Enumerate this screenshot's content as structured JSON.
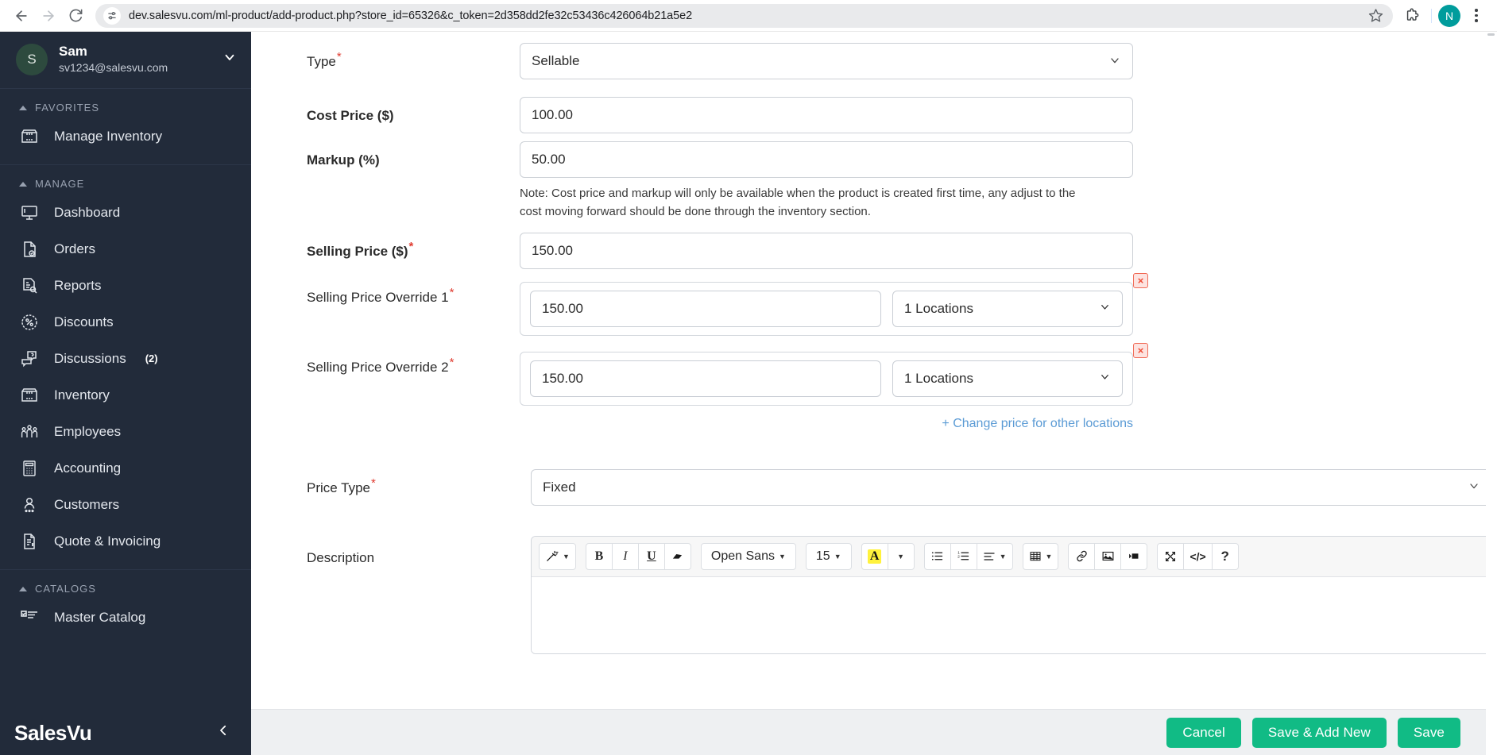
{
  "browser": {
    "url": "dev.salesvu.com/ml-product/add-product.php?store_id=65326&c_token=2d358dd2fe32c53436c426064b21a5e2",
    "back_icon": "back-arrow-icon",
    "forward_icon": "forward-arrow-icon",
    "reload_icon": "reload-icon",
    "site_info_icon": "site-settings-icon",
    "bookmark_icon": "star-icon",
    "extensions_icon": "puzzle-icon",
    "profile_initial": "N",
    "menu_icon": "kebab-menu-icon"
  },
  "sidebar": {
    "user": {
      "initial": "S",
      "name": "Sam",
      "email": "sv1234@salesvu.com"
    },
    "sections": [
      {
        "title": "FAVORITES",
        "items": [
          {
            "label": "Manage Inventory",
            "icon": "inventory-box-icon"
          }
        ]
      },
      {
        "title": "MANAGE",
        "items": [
          {
            "label": "Dashboard",
            "icon": "monitor-icon"
          },
          {
            "label": "Orders",
            "icon": "order-document-icon"
          },
          {
            "label": "Reports",
            "icon": "report-search-icon"
          },
          {
            "label": "Discounts",
            "icon": "percent-badge-icon"
          },
          {
            "label": "Discussions",
            "icon": "chat-question-icon",
            "badge": "(2)"
          },
          {
            "label": "Inventory",
            "icon": "inventory-box-icon"
          },
          {
            "label": "Employees",
            "icon": "people-group-icon"
          },
          {
            "label": "Accounting",
            "icon": "calculator-icon"
          },
          {
            "label": "Customers",
            "icon": "person-icon"
          },
          {
            "label": "Quote & Invoicing",
            "icon": "invoice-document-icon"
          }
        ]
      },
      {
        "title": "CATALOGS",
        "items": [
          {
            "label": "Master Catalog",
            "icon": "checklist-icon"
          }
        ]
      }
    ],
    "logo": "SalesVu",
    "collapse_icon": "chevron-left-icon"
  },
  "form": {
    "type": {
      "label": "Type",
      "required": true,
      "value": "Sellable"
    },
    "cost_price": {
      "label": "Cost Price ($)",
      "required": false,
      "value": "100.00"
    },
    "markup": {
      "label": "Markup (%)",
      "required": false,
      "value": "50.00"
    },
    "note": "Note: Cost price and markup will only be available when the product is created first time, any adjust to the cost moving forward should be done through the inventory section.",
    "selling_price": {
      "label": "Selling Price ($)",
      "required": true,
      "value": "150.00"
    },
    "overrides": [
      {
        "label": "Selling Price Override 1",
        "required": true,
        "price": "150.00",
        "locations": "1 Locations",
        "delete_icon": "delete-x-icon"
      },
      {
        "label": "Selling Price Override 2",
        "required": true,
        "price": "150.00",
        "locations": "1 Locations",
        "delete_icon": "delete-x-icon"
      }
    ],
    "add_location_link": "+ Change price for other locations",
    "price_type": {
      "label": "Price Type",
      "required": true,
      "value": "Fixed"
    },
    "description": {
      "label": "Description",
      "required": false
    }
  },
  "editor_toolbar": {
    "groups": [
      [
        {
          "icon": "magic-wand-icon",
          "glyph": "✨",
          "caret": true
        }
      ],
      [
        {
          "icon": "bold-icon",
          "glyph": "B"
        },
        {
          "icon": "italic-icon",
          "glyph": "I"
        },
        {
          "icon": "underline-icon",
          "glyph": "U"
        },
        {
          "icon": "eraser-icon",
          "glyph": "▰"
        }
      ],
      [
        {
          "icon": "font-family-select",
          "glyph": "Open Sans",
          "caret": true,
          "wide": true
        }
      ],
      [
        {
          "icon": "font-size-select",
          "glyph": "15",
          "caret": true
        }
      ],
      [
        {
          "icon": "text-color-icon",
          "glyph": "A",
          "highlight": true
        },
        {
          "icon": "color-dropdown-icon",
          "glyph": "",
          "caret": true
        }
      ],
      [
        {
          "icon": "unordered-list-icon",
          "glyph": "☰"
        },
        {
          "icon": "ordered-list-icon",
          "glyph": "☷"
        },
        {
          "icon": "paragraph-align-icon",
          "glyph": "≡",
          "caret": true
        }
      ],
      [
        {
          "icon": "table-icon",
          "glyph": "▦",
          "caret": true
        }
      ],
      [
        {
          "icon": "link-icon",
          "glyph": "ὑ7"
        },
        {
          "icon": "image-icon",
          "glyph": "ὛC"
        },
        {
          "icon": "video-icon",
          "glyph": "▶"
        }
      ],
      [
        {
          "icon": "fullscreen-icon",
          "glyph": "⤢"
        },
        {
          "icon": "code-view-icon",
          "glyph": "</>"
        },
        {
          "icon": "help-icon",
          "glyph": "?"
        }
      ]
    ]
  },
  "footer": {
    "cancel": "Cancel",
    "save_add_new": "Save & Add New",
    "save": "Save",
    "accent_color": "#11bb85"
  }
}
